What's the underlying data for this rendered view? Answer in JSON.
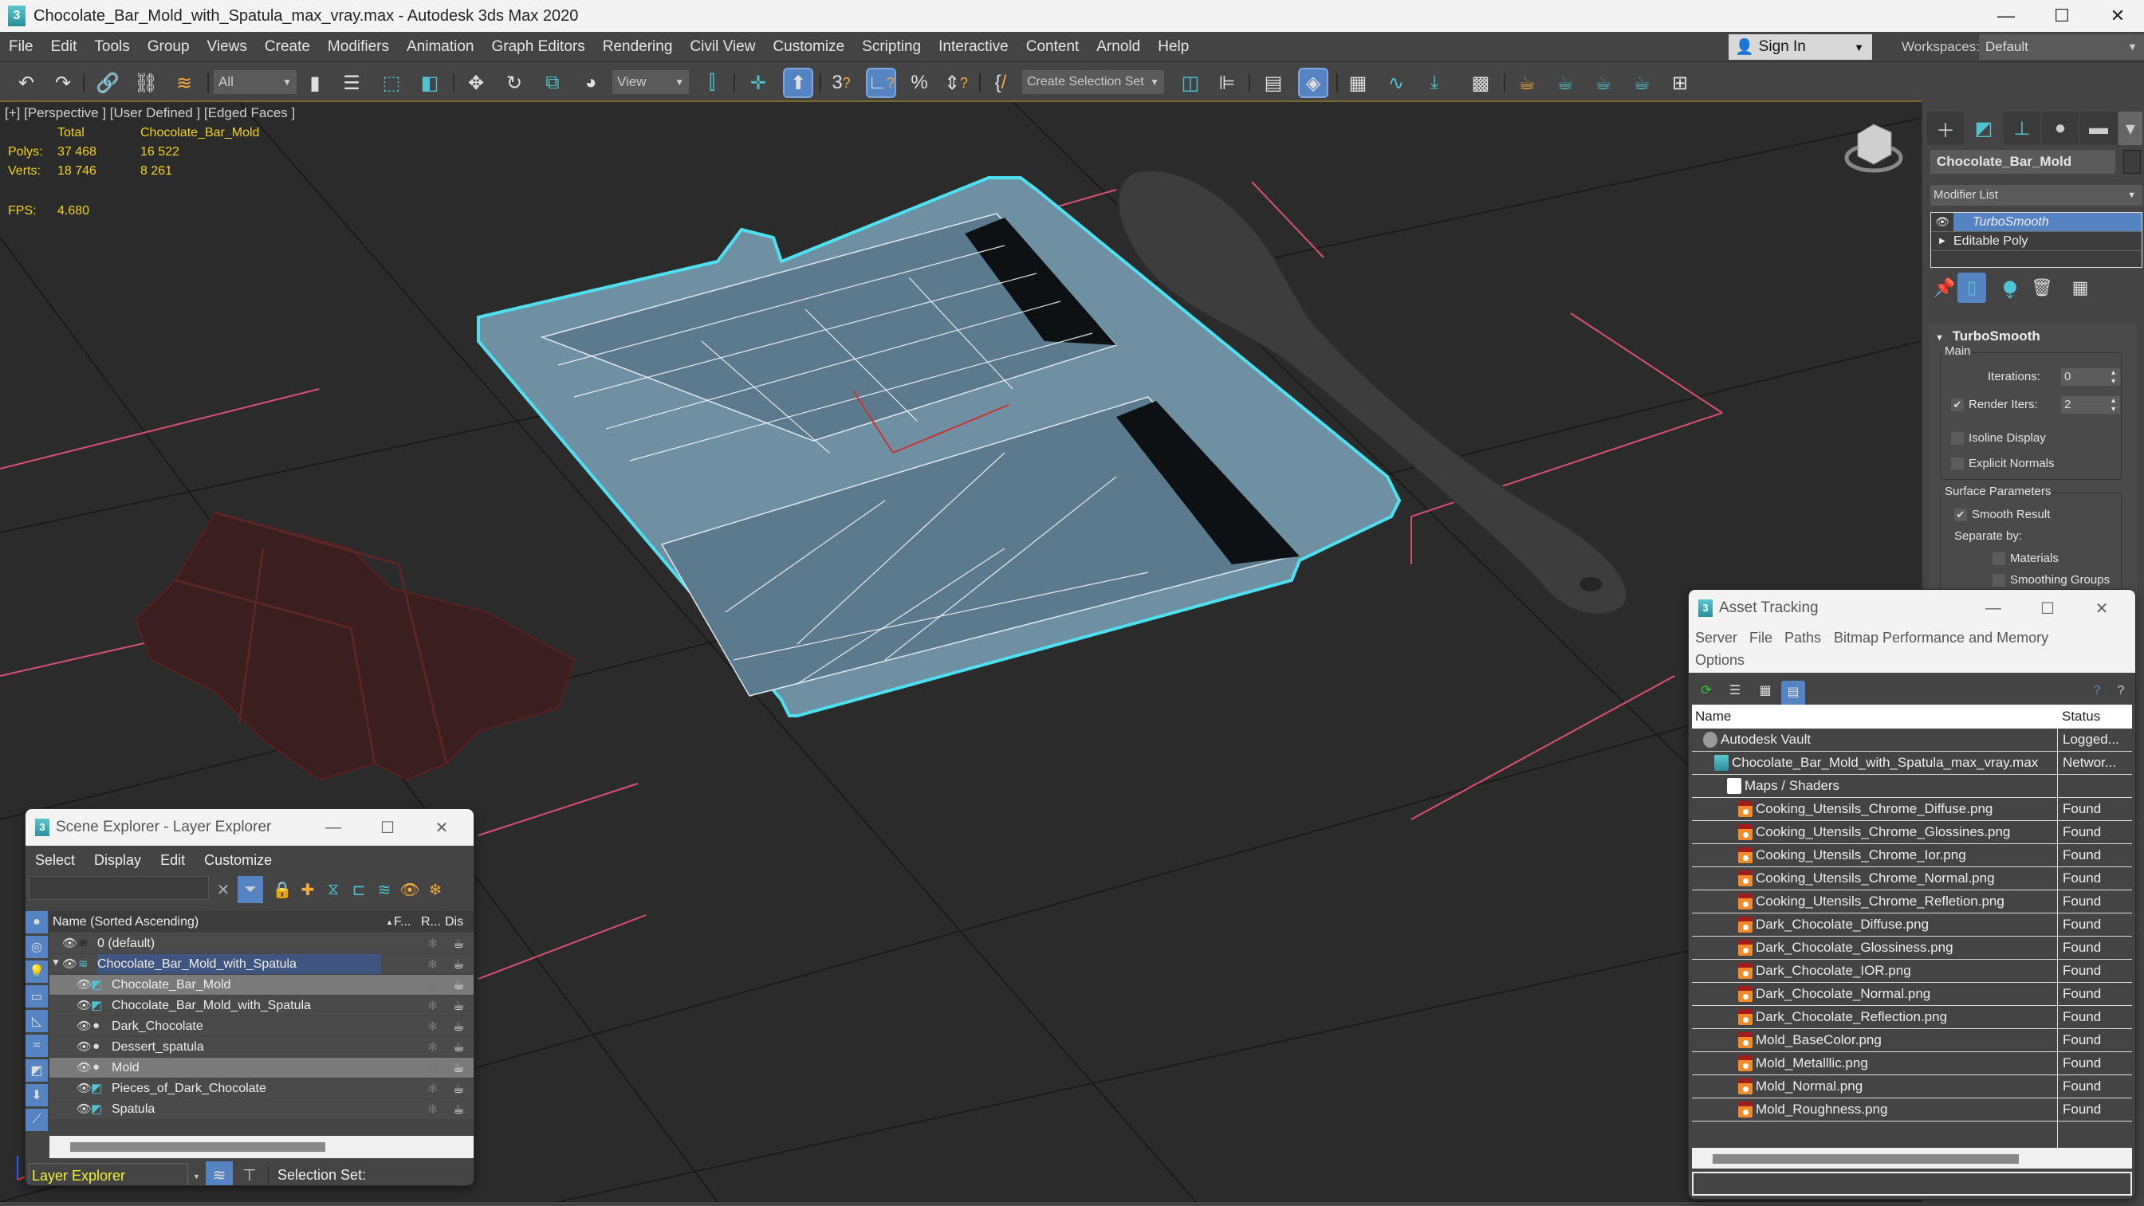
{
  "window": {
    "title": "Chocolate_Bar_Mold_with_Spatula_max_vray.max - Autodesk 3ds Max 2020",
    "minimize": "—",
    "maximize": "☐",
    "close": "✕"
  },
  "menu": [
    "File",
    "Edit",
    "Tools",
    "Group",
    "Views",
    "Create",
    "Modifiers",
    "Animation",
    "Graph Editors",
    "Rendering",
    "Civil View",
    "Customize",
    "Scripting",
    "Interactive",
    "Content",
    "Arnold",
    "Help"
  ],
  "account": {
    "sign_in": "Sign In",
    "workspaces_label": "Workspaces:",
    "workspace": "Default"
  },
  "toolbar": {
    "selection_filter": "All",
    "ref_coord": "View",
    "selection_set": "Create Selection Set",
    "icons": [
      "undo-icon",
      "redo-icon",
      "link-icon",
      "unlink-icon",
      "bind-spacewarp-icon",
      "select-object-icon",
      "select-by-name-icon",
      "rect-region-icon",
      "window-crossing-icon",
      "move-icon",
      "rotate-icon",
      "scale-icon",
      "place-icon",
      "pivot-icon",
      "select-manipulate-icon",
      "keyboard-shortcut-icon",
      "snap-3d-icon",
      "angle-snap-icon",
      "percent-snap-icon",
      "spinner-snap-icon",
      "edit-named-sets-icon",
      "mirror-icon",
      "align-icon",
      "scene-explorer-icon",
      "layer-explorer-icon",
      "toggle-ribbon-icon",
      "curve-editor-icon",
      "schematic-view-icon",
      "material-editor-icon",
      "render-setup-icon",
      "rendered-frame-icon",
      "render-production-icon",
      "render-cloud-icon",
      "viewport-layout-icon"
    ]
  },
  "viewport": {
    "label": "[+] [Perspective ] [User Defined ] [Edged Faces ]",
    "stats": {
      "col_total": "Total",
      "col_object": "Chocolate_Bar_Mold",
      "polys_label": "Polys:",
      "polys_total": "37 468",
      "polys_object": "16 522",
      "verts_label": "Verts:",
      "verts_total": "18 746",
      "verts_object": "8 261",
      "fps_label": "FPS:",
      "fps": "4.680"
    }
  },
  "command_panel": {
    "object_name": "Chocolate_Bar_Mold",
    "modifier_list": "Modifier List",
    "stack": [
      {
        "name": "TurboSmooth",
        "selected": true
      },
      {
        "name": "Editable Poly",
        "selected": false
      }
    ],
    "rollout_title": "TurboSmooth",
    "main_group": "Main",
    "iterations_label": "Iterations:",
    "iterations": "0",
    "render_iters_label": "Render Iters:",
    "render_iters": "2",
    "render_iters_checked": true,
    "isoline_label": "Isoline Display",
    "isoline_checked": false,
    "explicit_normals_label": "Explicit Normals",
    "explicit_normals_checked": false,
    "surface_group": "Surface Parameters",
    "smooth_result_label": "Smooth Result",
    "smooth_result_checked": true,
    "separate_by_label": "Separate by:",
    "materials_label": "Materials",
    "smoothing_groups_label": "Smoothing Groups",
    "check_glyph": "✔"
  },
  "scene_explorer": {
    "title": "Scene Explorer - Layer Explorer",
    "menu": [
      "Select",
      "Display",
      "Edit",
      "Customize"
    ],
    "columns": {
      "name": "Name (Sorted Ascending)",
      "freeze": "F...",
      "render": "R...",
      "display": "Dis"
    },
    "rows": [
      {
        "name": "0 (default)",
        "type": "layer",
        "level": 0
      },
      {
        "name": "Chocolate_Bar_Mold_with_Spatula",
        "type": "layer-active",
        "level": 0
      },
      {
        "name": "Chocolate_Bar_Mold",
        "type": "group",
        "level": 1,
        "selected": true
      },
      {
        "name": "Chocolate_Bar_Mold_with_Spatula",
        "type": "group",
        "level": 1
      },
      {
        "name": "Dark_Chocolate",
        "type": "geometry",
        "level": 1
      },
      {
        "name": "Dessert_spatula",
        "type": "geometry",
        "level": 1
      },
      {
        "name": "Mold",
        "type": "geometry",
        "level": 1,
        "selected": true
      },
      {
        "name": "Pieces_of_Dark_Chocolate",
        "type": "group",
        "level": 1
      },
      {
        "name": "Spatula",
        "type": "group",
        "level": 1
      }
    ],
    "explorer_mode": "Layer Explorer",
    "selection_set_label": "Selection Set:"
  },
  "asset_tracking": {
    "title": "Asset Tracking",
    "menu": [
      "Server",
      "File",
      "Paths",
      "Bitmap Performance and Memory",
      "Options"
    ],
    "columns": {
      "name": "Name",
      "status": "Status"
    },
    "rows": [
      {
        "name": "Autodesk Vault",
        "status": "Logged...",
        "level": 0,
        "icon": "vault"
      },
      {
        "name": "Chocolate_Bar_Mold_with_Spatula_max_vray.max",
        "status": "Networ...",
        "level": 1,
        "icon": "max"
      },
      {
        "name": "Maps / Shaders",
        "status": "",
        "level": 2,
        "icon": "maps"
      },
      {
        "name": "Cooking_Utensils_Chrome_Diffuse.png",
        "status": "Found",
        "level": 3,
        "icon": "png"
      },
      {
        "name": "Cooking_Utensils_Chrome_Glossines.png",
        "status": "Found",
        "level": 3,
        "icon": "png"
      },
      {
        "name": "Cooking_Utensils_Chrome_Ior.png",
        "status": "Found",
        "level": 3,
        "icon": "png"
      },
      {
        "name": "Cooking_Utensils_Chrome_Normal.png",
        "status": "Found",
        "level": 3,
        "icon": "png"
      },
      {
        "name": "Cooking_Utensils_Chrome_Refletion.png",
        "status": "Found",
        "level": 3,
        "icon": "png"
      },
      {
        "name": "Dark_Chocolate_Diffuse.png",
        "status": "Found",
        "level": 3,
        "icon": "png"
      },
      {
        "name": "Dark_Chocolate_Glossiness.png",
        "status": "Found",
        "level": 3,
        "icon": "png"
      },
      {
        "name": "Dark_Chocolate_IOR.png",
        "status": "Found",
        "level": 3,
        "icon": "png"
      },
      {
        "name": "Dark_Chocolate_Normal.png",
        "status": "Found",
        "level": 3,
        "icon": "png"
      },
      {
        "name": "Dark_Chocolate_Reflection.png",
        "status": "Found",
        "level": 3,
        "icon": "png"
      },
      {
        "name": "Mold_BaseColor.png",
        "status": "Found",
        "level": 3,
        "icon": "png"
      },
      {
        "name": "Mold_Metalllic.png",
        "status": "Found",
        "level": 3,
        "icon": "png"
      },
      {
        "name": "Mold_Normal.png",
        "status": "Found",
        "level": 3,
        "icon": "png"
      },
      {
        "name": "Mold_Roughness.png",
        "status": "Found",
        "level": 3,
        "icon": "png"
      }
    ]
  },
  "colors": {
    "accent_blue": "#5683c1",
    "selection_cyan": "#4fe0f0",
    "stats_yellow": "#f2d31b",
    "mold_surface": "#6f8fa3",
    "chocolate": "#3a1d1d",
    "spatula": "#3d3d3d",
    "grid_line": "#1d1d1d",
    "bbox_pink": "#e0557a"
  }
}
